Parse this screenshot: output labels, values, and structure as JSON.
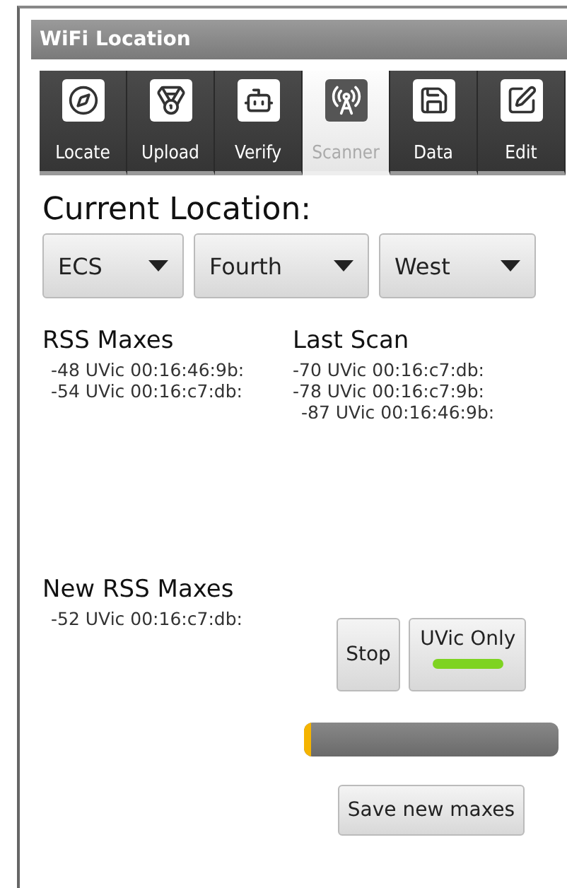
{
  "window": {
    "title": "WiFi Location"
  },
  "tabs": [
    {
      "label": "Locate",
      "kind": "compass",
      "selected": false
    },
    {
      "label": "Upload",
      "kind": "medal",
      "selected": false
    },
    {
      "label": "Verify",
      "kind": "robot",
      "selected": false
    },
    {
      "label": "Scanner",
      "kind": "antenna",
      "selected": true
    },
    {
      "label": "Data",
      "kind": "floppy",
      "selected": false
    },
    {
      "label": "Edit",
      "kind": "edit",
      "selected": false
    }
  ],
  "current_location": {
    "heading": "Current Location:",
    "spinners": [
      "ECS",
      "Fourth",
      "West"
    ]
  },
  "rss_maxes": {
    "heading": "RSS Maxes",
    "entries": [
      "-48 UVic 00:16:46:9b:",
      "-54 UVic 00:16:c7:db:"
    ]
  },
  "last_scan": {
    "heading": "Last Scan",
    "entries": [
      "-70 UVic 00:16:c7:db:",
      "-78 UVic 00:16:c7:9b:",
      "-87 UVic 00:16:46:9b:"
    ]
  },
  "new_rss_maxes": {
    "heading": "New RSS Maxes",
    "entries": [
      "-52 UVic 00:16:c7:db:"
    ]
  },
  "stop_button": "Stop",
  "uvic_only": {
    "label": "UVic Only",
    "on": true
  },
  "progress": {
    "level": 0.03
  },
  "save_button": "Save new maxes"
}
